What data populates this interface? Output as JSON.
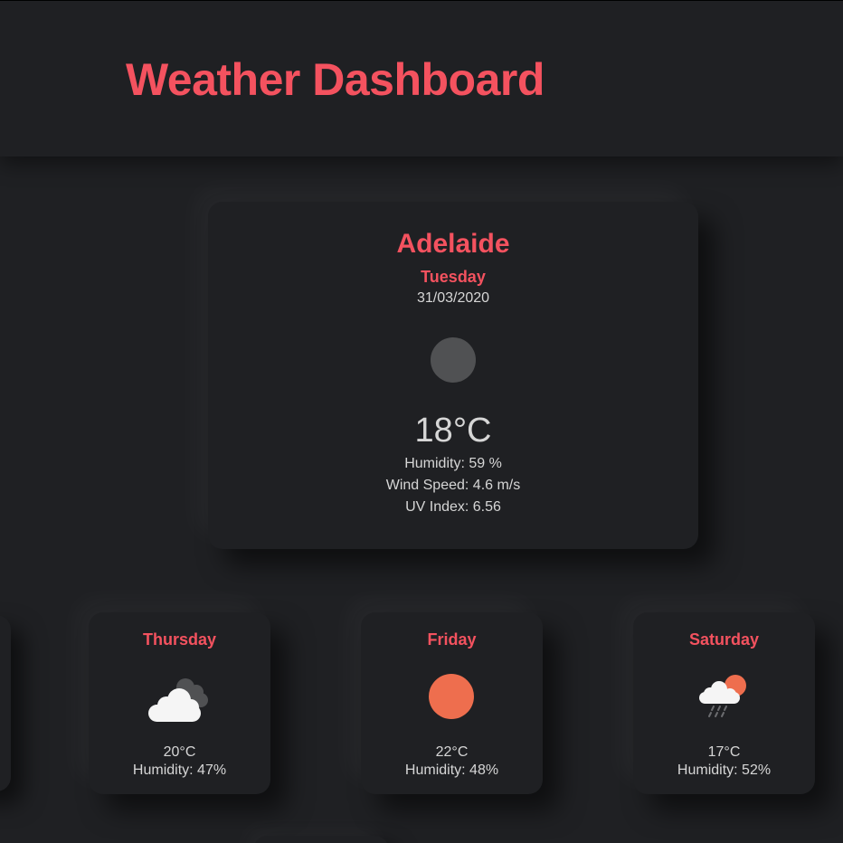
{
  "header": {
    "title": "Weather Dashboard"
  },
  "current": {
    "city": "Adelaide",
    "day": "Tuesday",
    "date": "31/03/2020",
    "icon": "circle-icon",
    "temperature": "18°C",
    "humidity": "Humidity: 59 %",
    "wind_speed": "Wind Speed: 4.6 m/s",
    "uv_index": "UV Index: 6.56"
  },
  "forecast": [
    {
      "day": "Thursday",
      "icon": "cloudy-icon",
      "temperature": "20°C",
      "humidity": "Humidity: 47%"
    },
    {
      "day": "Friday",
      "icon": "sun-icon",
      "temperature": "22°C",
      "humidity": "Humidity: 48%"
    },
    {
      "day": "Saturday",
      "icon": "rain-sun-icon",
      "temperature": "17°C",
      "humidity": "Humidity: 52%"
    }
  ],
  "colors": {
    "background": "#1f2023",
    "accent": "#f4525f",
    "text": "#d6d6d6",
    "sun": "#ee6e4e",
    "icon_gray": "#505153"
  }
}
